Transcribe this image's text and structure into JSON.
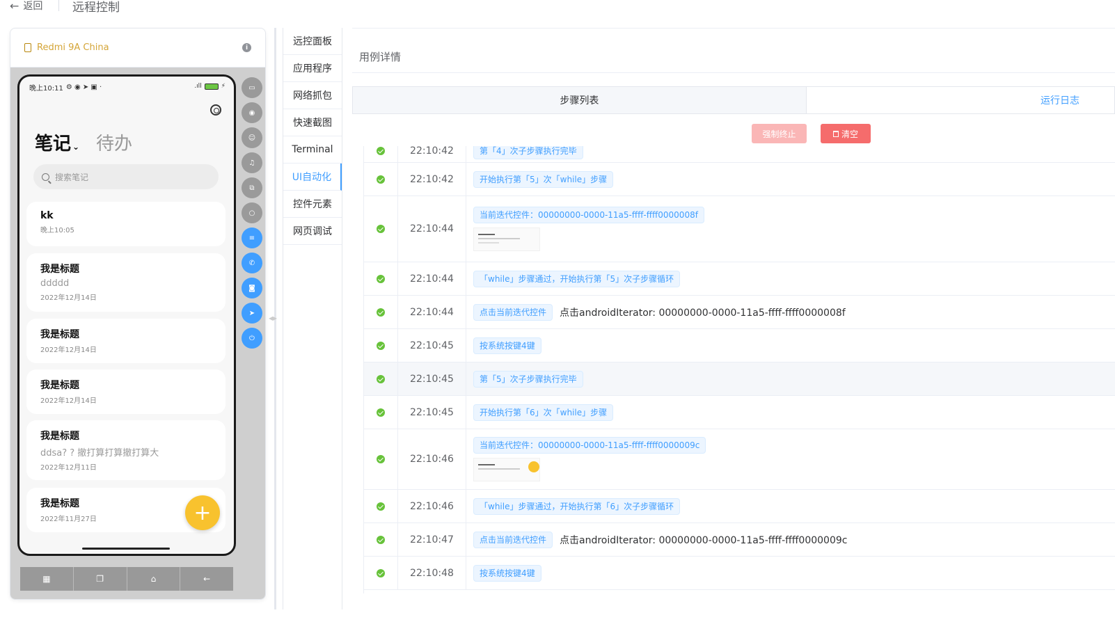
{
  "header": {
    "back_label": "返回",
    "title": "远程控制"
  },
  "device": {
    "name": "Redmi 9A China",
    "phone": {
      "status_time": "晚上10:11",
      "tab_notes": "笔记",
      "tab_todo": "待办",
      "search_placeholder": "搜索笔记",
      "notes": [
        {
          "title": "kk",
          "body": "",
          "date": "晚上10:05"
        },
        {
          "title": "我是标题",
          "body": "ddddd",
          "date": "2022年12月14日"
        },
        {
          "title": "我是标题",
          "body": "",
          "date": "2022年12月14日"
        },
        {
          "title": "我是标题",
          "body": "",
          "date": "2022年12月14日"
        },
        {
          "title": "我是标题",
          "body": "ddsa? ? 撤打算打算撤打算大",
          "date": "2022年12月11日"
        },
        {
          "title": "我是标题",
          "body": "",
          "date": "2022年11月27日"
        }
      ]
    },
    "tools": [
      "video-icon",
      "eye-icon",
      "user-icon",
      "headset-icon",
      "copy-icon",
      "search-icon",
      "sliders-icon",
      "phone-icon",
      "camera-icon",
      "location-icon",
      "power-icon"
    ],
    "nav_buttons": [
      "apps-icon",
      "recent-icon",
      "home-icon",
      "back-icon"
    ]
  },
  "menu": {
    "items": [
      "远控面板",
      "应用程序",
      "网络抓包",
      "快速截图",
      "Terminal",
      "UI自动化",
      "控件元素",
      "网页调试"
    ],
    "active_index": 5
  },
  "main": {
    "section_title": "用例详情",
    "tab_steps": "步骤列表",
    "tab_log": "运行日志",
    "btn_stop": "强制终止",
    "btn_clear": "清空",
    "rows": [
      {
        "time": "22:10:42",
        "tag": "第「4」次子步骤执行完毕",
        "text": ""
      },
      {
        "time": "22:10:42",
        "tag": "开始执行第「5」次「while」步骤",
        "text": ""
      },
      {
        "time": "22:10:44",
        "tag": "当前迭代控件：00000000-0000-11a5-ffff-ffff0000008f",
        "text": ""
      },
      {
        "time": "22:10:44",
        "tag": "「while」步骤通过，开始执行第「5」次子步骤循环",
        "text": ""
      },
      {
        "time": "22:10:44",
        "tag": "点击当前迭代控件",
        "text": "点击androidIterator: 00000000-0000-11a5-ffff-ffff0000008f"
      },
      {
        "time": "22:10:45",
        "tag": "按系统按键4键",
        "text": ""
      },
      {
        "time": "22:10:45",
        "tag": "第「5」次子步骤执行完毕",
        "text": ""
      },
      {
        "time": "22:10:45",
        "tag": "开始执行第「6」次「while」步骤",
        "text": ""
      },
      {
        "time": "22:10:46",
        "tag": "当前迭代控件：00000000-0000-11a5-ffff-ffff0000009c",
        "text": ""
      },
      {
        "time": "22:10:46",
        "tag": "「while」步骤通过，开始执行第「6」次子步骤循环",
        "text": ""
      },
      {
        "time": "22:10:47",
        "tag": "点击当前迭代控件",
        "text": "点击androidIterator: 00000000-0000-11a5-ffff-ffff0000009c"
      },
      {
        "time": "22:10:48",
        "tag": "按系统按键4键",
        "text": ""
      }
    ]
  },
  "colors": {
    "primary": "#409eff",
    "success": "#67c23a",
    "danger": "#f56c6c",
    "device_name": "#d4a537",
    "fab": "#f8c22e"
  }
}
